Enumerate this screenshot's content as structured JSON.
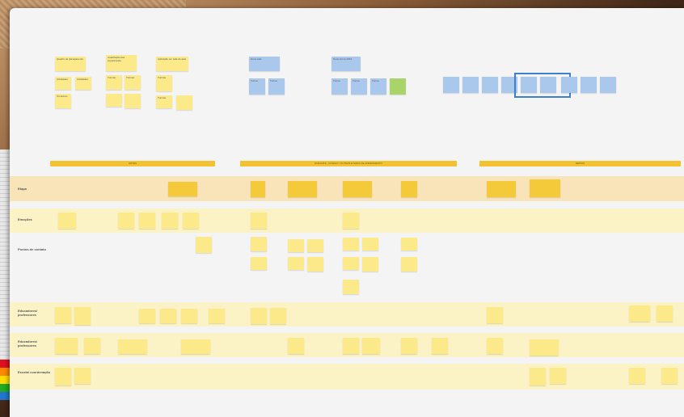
{
  "board": {
    "bands": [
      {
        "label": "ANTES"
      },
      {
        "label": "DURANTE - CÓDIGO / OUTRAS ETAPAS DE ATENDIMENTO"
      },
      {
        "label": "DEPOIS"
      }
    ],
    "lanes": [
      {
        "label": "Etapa"
      },
      {
        "label": "Emoções"
      },
      {
        "label": "Pontos de contato"
      },
      {
        "label": "Educadores/ professores"
      },
      {
        "label": "Educadores/ professores"
      },
      {
        "label": "Escola/ coordenação"
      }
    ],
    "header_notes": {
      "yellow_group_1": [
        "Quadro de planejamento",
        "Atividades",
        "Atividades",
        "Os alunos"
      ],
      "yellow_group_2": [
        "Atualização das experiências",
        "Turmas",
        "Turmas"
      ],
      "yellow_group_3": [
        "Aplicação em sala de aula",
        "Turmas",
        "Turmas"
      ],
      "blue_group_1": [
        "Nova sala",
        "Turma",
        "Turma"
      ],
      "blue_group_2": [
        "Nova turma 2023",
        "Turma",
        "Turma",
        "Turma"
      ]
    }
  }
}
